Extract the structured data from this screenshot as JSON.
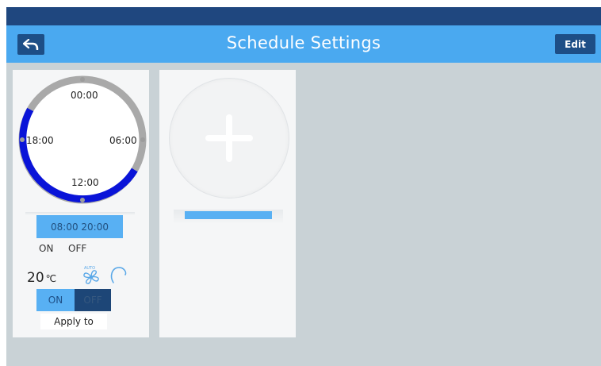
{
  "header": {
    "title": "Schedule Settings",
    "back_icon": "back-arrow-icon",
    "edit_label": "Edit"
  },
  "schedule_card": {
    "clock": {
      "labels": {
        "top": "00:00",
        "right": "06:00",
        "bottom": "12:00",
        "left": "18:00"
      },
      "active_color": "#0a14d8",
      "track_color": "#a9a9a9"
    },
    "time_range": "08:00 20:00",
    "on_label": "ON",
    "off_label": "OFF",
    "temperature": "20",
    "temperature_unit": "℃",
    "fan_mode_icon": "fan-auto-icon",
    "fan_mode_label": "AUTO",
    "swing_icon": "swing-icon",
    "toggle": {
      "on": "ON",
      "off": "OFF",
      "state": "ON"
    },
    "apply_label": "Apply to"
  },
  "add_card": {
    "icon": "plus-icon"
  },
  "colors": {
    "status_bar": "#1f477f",
    "header": "#4aa9f0",
    "accent": "#58b0f3",
    "dark_button": "#1d4e86",
    "background": "#c9d2d6"
  }
}
